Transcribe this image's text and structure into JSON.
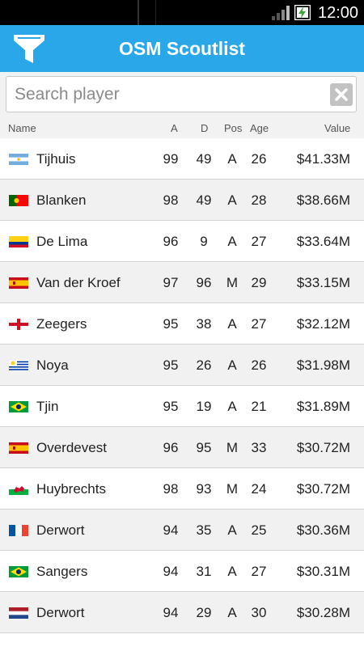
{
  "status_bar": {
    "time": "12:00",
    "signal_icon": "signal-bars-icon",
    "battery_icon": "battery-charging-icon"
  },
  "action_bar": {
    "title": "OSM Scoutlist",
    "filter_icon": "filter-funnel-icon",
    "color": "#29a7e8"
  },
  "search": {
    "placeholder": "Search player",
    "value": "",
    "clear_icon": "clear-x-icon"
  },
  "columns": {
    "name": "Name",
    "a": "A",
    "d": "D",
    "pos": "Pos",
    "age": "Age",
    "value": "Value"
  },
  "players": [
    {
      "flag": "argentina",
      "name": "Tijhuis",
      "a": "99",
      "d": "49",
      "pos": "A",
      "age": "26",
      "value": "$41.33M"
    },
    {
      "flag": "portugal",
      "name": "Blanken",
      "a": "98",
      "d": "49",
      "pos": "A",
      "age": "28",
      "value": "$38.66M"
    },
    {
      "flag": "colombia",
      "name": "De Lima",
      "a": "96",
      "d": "9",
      "pos": "A",
      "age": "27",
      "value": "$33.64M"
    },
    {
      "flag": "spain",
      "name": "Van der Kroef",
      "a": "97",
      "d": "96",
      "pos": "M",
      "age": "29",
      "value": "$33.15M"
    },
    {
      "flag": "england",
      "name": "Zeegers",
      "a": "95",
      "d": "38",
      "pos": "A",
      "age": "27",
      "value": "$32.12M"
    },
    {
      "flag": "uruguay",
      "name": "Noya",
      "a": "95",
      "d": "26",
      "pos": "A",
      "age": "26",
      "value": "$31.98M"
    },
    {
      "flag": "brazil",
      "name": "Tjin",
      "a": "95",
      "d": "19",
      "pos": "A",
      "age": "21",
      "value": "$31.89M"
    },
    {
      "flag": "spain",
      "name": "Overdevest",
      "a": "96",
      "d": "95",
      "pos": "M",
      "age": "33",
      "value": "$30.72M"
    },
    {
      "flag": "wales",
      "name": "Huybrechts",
      "a": "98",
      "d": "93",
      "pos": "M",
      "age": "24",
      "value": "$30.72M"
    },
    {
      "flag": "france",
      "name": "Derwort",
      "a": "94",
      "d": "35",
      "pos": "A",
      "age": "25",
      "value": "$30.36M"
    },
    {
      "flag": "brazil",
      "name": "Sangers",
      "a": "94",
      "d": "31",
      "pos": "A",
      "age": "27",
      "value": "$30.31M"
    },
    {
      "flag": "netherlands",
      "name": "Derwort",
      "a": "94",
      "d": "29",
      "pos": "A",
      "age": "30",
      "value": "$30.28M"
    }
  ]
}
